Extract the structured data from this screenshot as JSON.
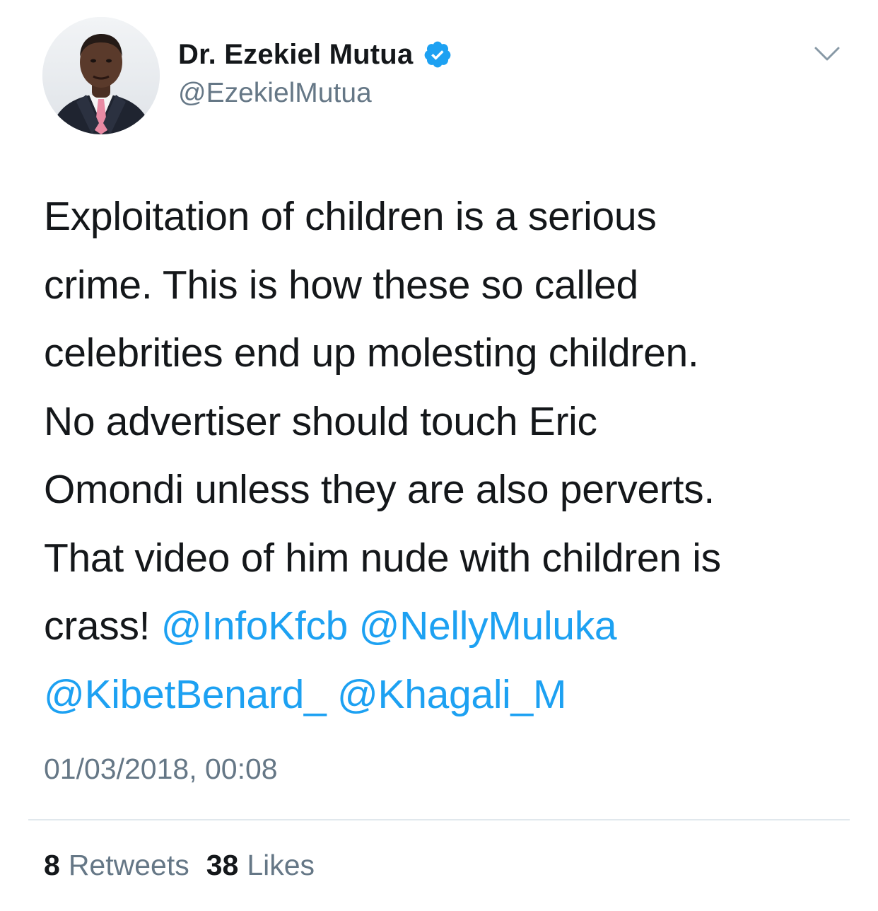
{
  "author": {
    "display_name": "Dr. Ezekiel Mutua",
    "handle": "@EzekielMutua",
    "verified_icon": "verified-badge-icon",
    "avatar_icon": "profile-photo"
  },
  "menu": {
    "icon": "chevron-down-icon"
  },
  "tweet": {
    "lines": [
      "Exploitation of children is a serious",
      "crime. This is how these so called",
      "celebrities end up molesting children.",
      "No advertiser should touch Eric",
      "Omondi unless they are also perverts.",
      "That video of him nude with children is"
    ],
    "line7_text": "crass!",
    "mentions": [
      "@InfoKfcb",
      "@NellyMuluka",
      "@KibetBenard_",
      "@Khagali_M"
    ],
    "timestamp": "01/03/2018, 00:08"
  },
  "stats": {
    "retweets_count": "8",
    "retweets_label": "Retweets",
    "likes_count": "38",
    "likes_label": "Likes"
  },
  "colors": {
    "accent": "#1da1f2",
    "text": "#14171a",
    "secondary": "#657786",
    "divider": "#e1e8ed"
  }
}
